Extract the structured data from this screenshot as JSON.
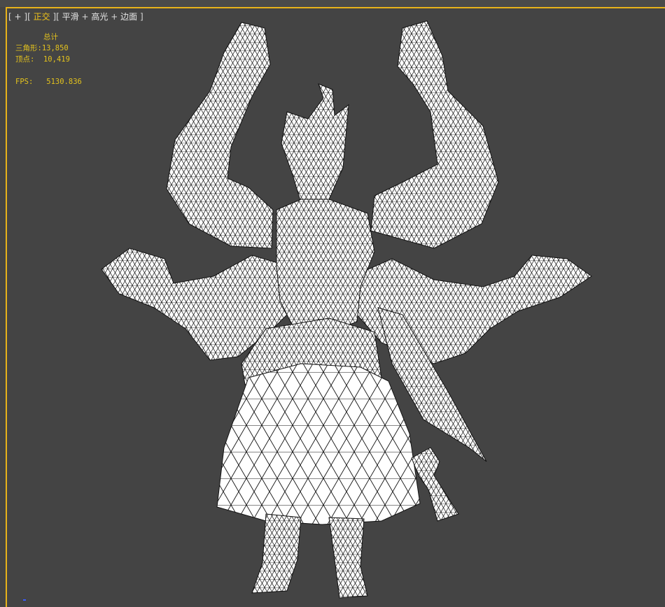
{
  "viewport": {
    "label": {
      "open_bracket": "[",
      "plus": "+",
      "sep1": "][",
      "view": "正交",
      "sep2": "][",
      "shading": "平滑",
      "plus2": "+",
      "highlights": "高光",
      "plus3": "+",
      "edged_faces": "边面",
      "close_bracket": "]"
    },
    "stats": {
      "title": "总计",
      "triangles_label": "三角形:",
      "triangles_value": "13,850",
      "vertices_label": "顶点:",
      "vertices_value": "10,419",
      "fps_label": "FPS:",
      "fps_value": "5130.836"
    },
    "colors": {
      "background": "#444444",
      "active_border": "#e8b21a",
      "stats_text": "#e3c21d",
      "label_text": "#e6e6e6",
      "mesh_fill": "#ffffff",
      "wire": "#000000"
    }
  }
}
